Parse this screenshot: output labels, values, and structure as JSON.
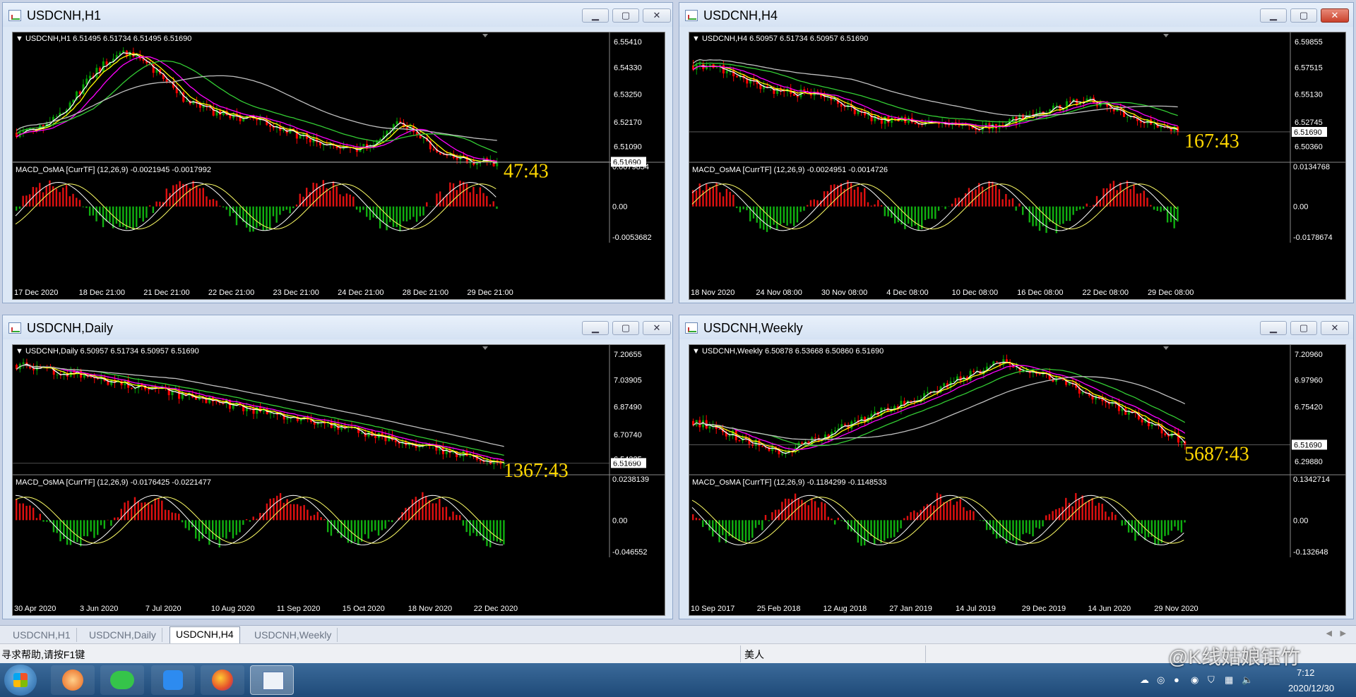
{
  "windows": [
    {
      "id": "h1",
      "title": "USDCNH,H1",
      "active": false,
      "info": "USDCNH,H1  6.51495 6.51734 6.51495 6.51690",
      "prices": [
        "6.55410",
        "6.54330",
        "6.53250",
        "6.52170",
        "6.51690",
        "6.51090"
      ],
      "timer": "47:43",
      "macd_label": "MACD_OsMA [CurrTF] (12,26,9) -0.0021945 -0.0017992",
      "macd_scale": [
        "0.0079854",
        "0.00",
        "-0.0053682"
      ],
      "dates": [
        "17 Dec 2020",
        "18 Dec 21:00",
        "21 Dec 21:00",
        "22 Dec 21:00",
        "23 Dec 21:00",
        "24 Dec 21:00",
        "28 Dec 21:00",
        "29 Dec 21:00"
      ]
    },
    {
      "id": "h4",
      "title": "USDCNH,H4",
      "active": true,
      "info": "USDCNH,H4  6.50957 6.51734 6.50957 6.51690",
      "prices": [
        "6.59855",
        "6.57515",
        "6.55130",
        "6.52745",
        "6.51690",
        "6.50360"
      ],
      "timer": "167:43",
      "macd_label": "MACD_OsMA [CurrTF] (12,26,9) -0.0024951 -0.0014726",
      "macd_scale": [
        "0.0134768",
        "0.00",
        "-0.0178674"
      ],
      "dates": [
        "18 Nov 2020",
        "24 Nov 08:00",
        "30 Nov 08:00",
        "4 Dec 08:00",
        "10 Dec 08:00",
        "16 Dec 08:00",
        "22 Dec 08:00",
        "29 Dec 08:00"
      ]
    },
    {
      "id": "d1",
      "title": "USDCNH,Daily",
      "active": false,
      "info": "USDCNH,Daily  6.50957 6.51734 6.50957 6.51690",
      "prices": [
        "7.20655",
        "7.03905",
        "6.87490",
        "6.70740",
        "6.51690",
        "6.54325"
      ],
      "timer": "1367:43",
      "macd_label": "MACD_OsMA [CurrTF] (12,26,9) -0.0176425 -0.0221477",
      "macd_scale": [
        "0.0238139",
        "0.00",
        "-0.046552"
      ],
      "dates": [
        "30 Apr 2020",
        "3 Jun 2020",
        "7 Jul 2020",
        "10 Aug 2020",
        "11 Sep 2020",
        "15 Oct 2020",
        "18 Nov 2020",
        "22 Dec 2020"
      ]
    },
    {
      "id": "w1",
      "title": "USDCNH,Weekly",
      "active": false,
      "info": "USDCNH,Weekly  6.50878 6.53668 6.50860 6.51690",
      "prices": [
        "7.20960",
        "6.97960",
        "6.75420",
        "6.51690",
        "6.29880"
      ],
      "timer": "5687:43",
      "macd_label": "MACD_OsMA [CurrTF] (12,26,9) -0.1184299 -0.1148533",
      "macd_scale": [
        "0.1342714",
        "0.00",
        "-0.132648"
      ],
      "dates": [
        "10 Sep 2017",
        "25 Feb 2018",
        "12 Aug 2018",
        "27 Jan 2019",
        "14 Jul 2019",
        "29 Dec 2019",
        "14 Jun 2020",
        "29 Nov 2020"
      ]
    }
  ],
  "tabs": [
    "USDCNH,H1",
    "USDCNH,Daily",
    "USDCNH,H4",
    "USDCNH,Weekly"
  ],
  "active_tab": "USDCNH,H4",
  "status": {
    "help": "寻求帮助,请按F1键",
    "profile": "美人"
  },
  "watermark": "@K线姑娘钰竹",
  "clock": {
    "time": "7:12",
    "date": "2020/12/30"
  },
  "colors": {
    "candle_up": "#00a000",
    "candle_down": "#ff0000",
    "timer": "#ffd700",
    "bg": "#000000"
  }
}
